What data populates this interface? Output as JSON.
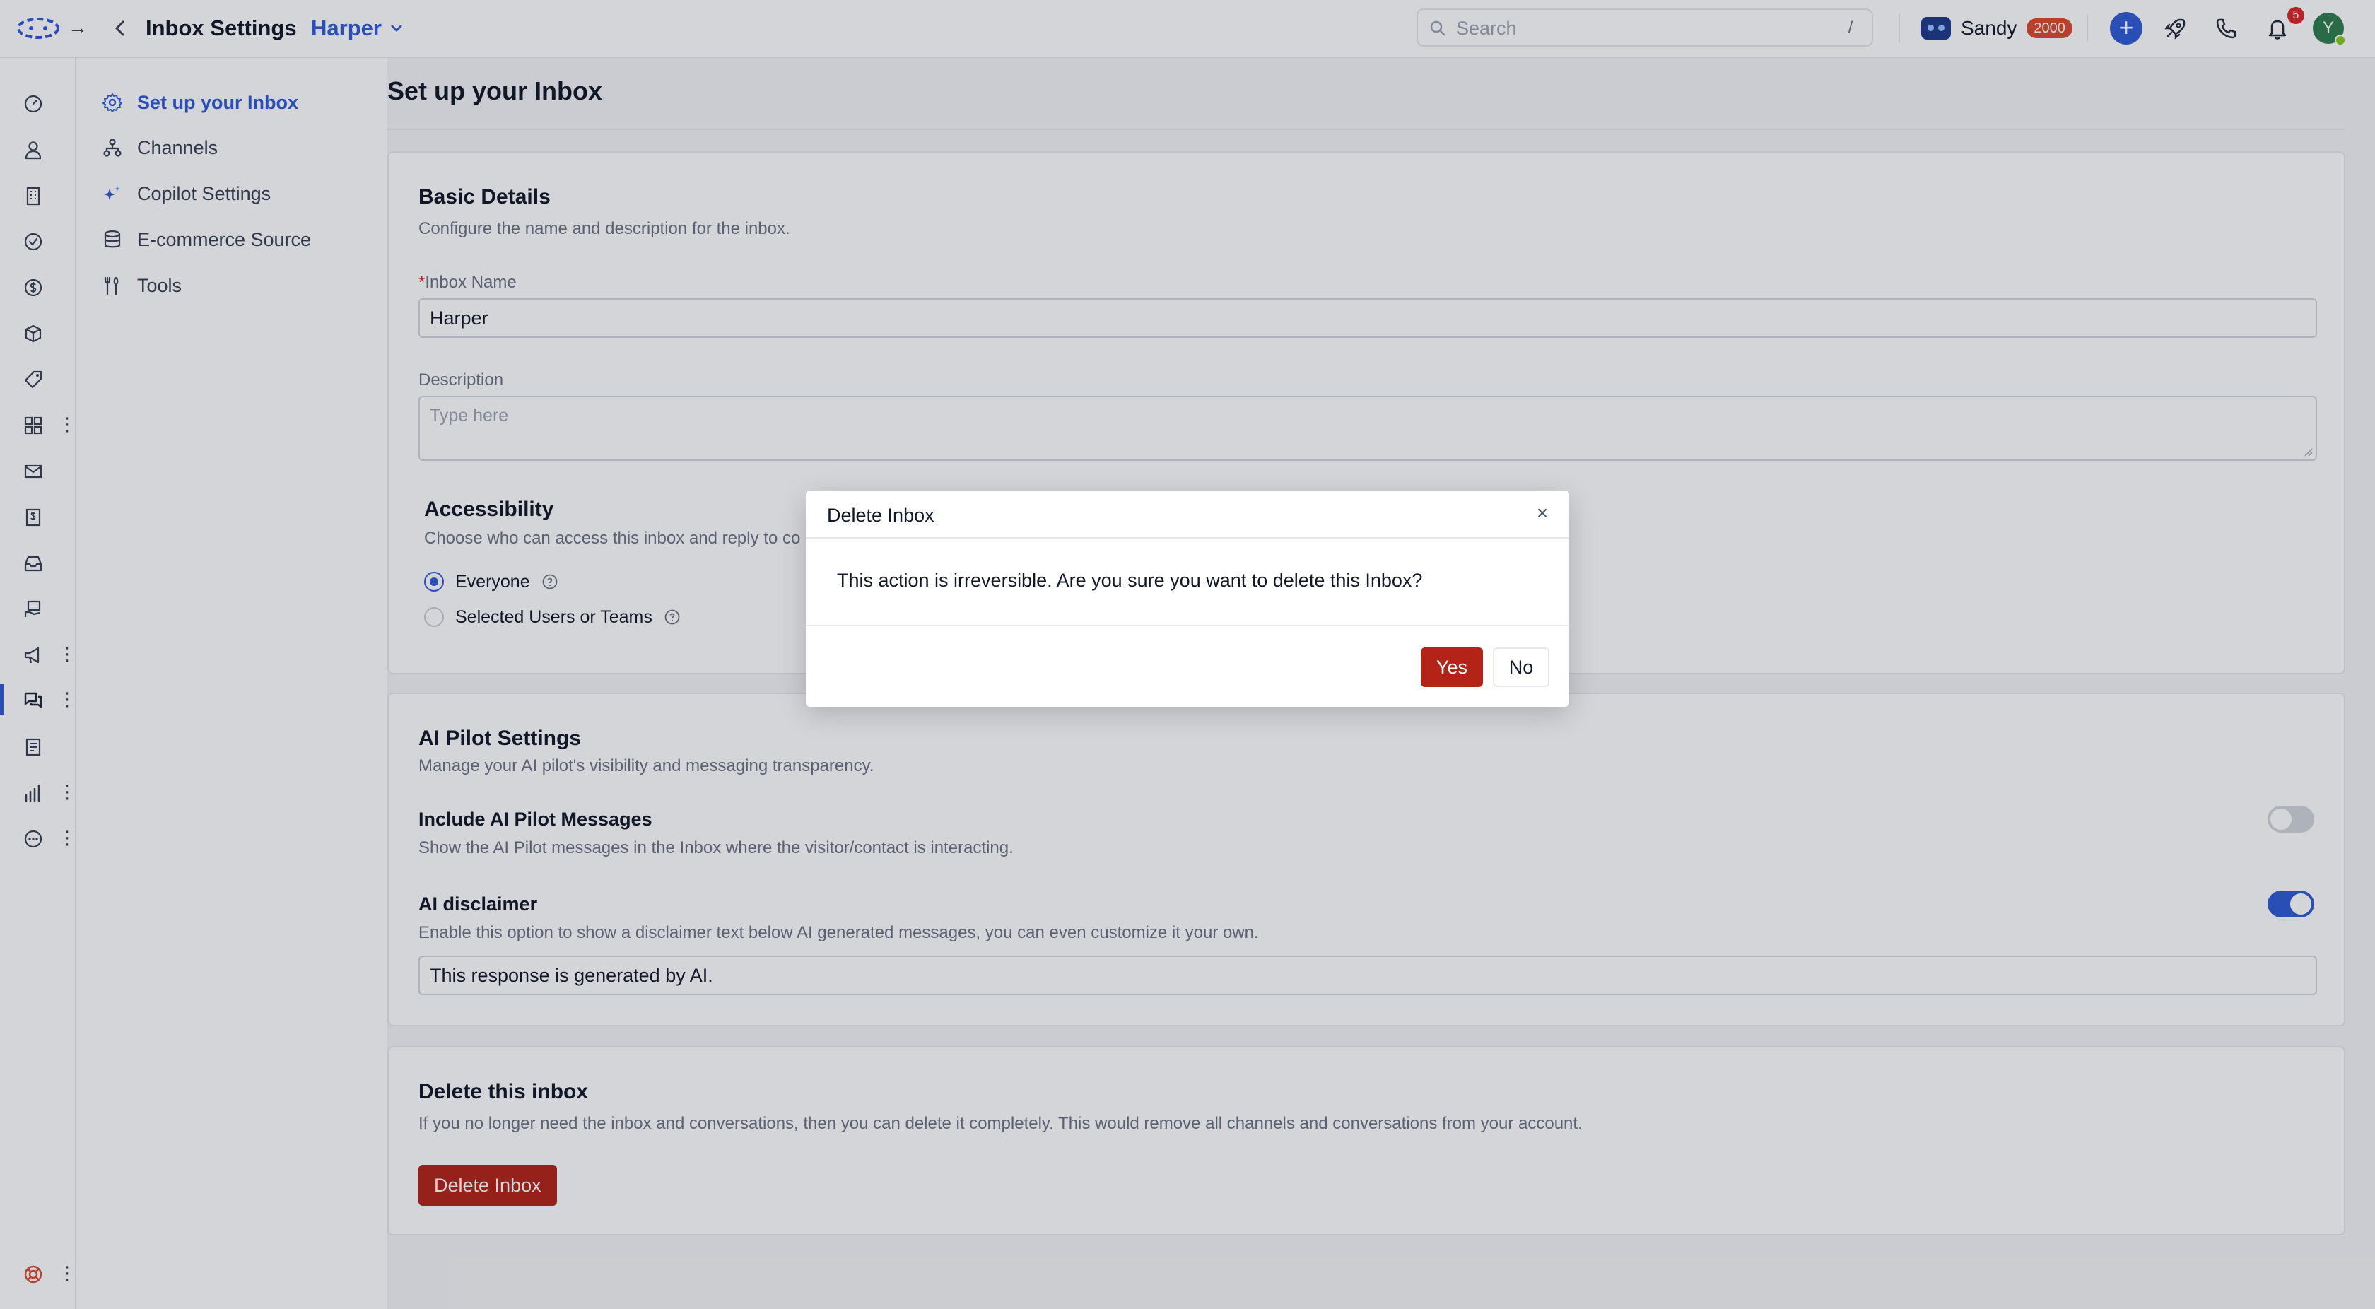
{
  "topbar": {
    "title": "Inbox Settings",
    "inbox_name": "Harper",
    "search_placeholder": "Search",
    "search_shortcut": "/",
    "agent_name": "Sandy",
    "agent_credits": "2000",
    "notification_count": "5",
    "avatar_initial": "Y"
  },
  "subnav": {
    "items": [
      {
        "label": "Set up your Inbox",
        "icon": "gear-icon",
        "active": true
      },
      {
        "label": "Channels",
        "icon": "channels-icon"
      },
      {
        "label": "Copilot Settings",
        "icon": "sparkle-icon"
      },
      {
        "label": "E-commerce Source",
        "icon": "database-icon"
      },
      {
        "label": "Tools",
        "icon": "tools-icon"
      }
    ]
  },
  "main": {
    "title": "Set up your Inbox",
    "basic": {
      "title": "Basic Details",
      "subtitle": "Configure the name and description for the inbox.",
      "name_required_mark": "*",
      "name_label": "Inbox Name",
      "name_value": "Harper",
      "description_label": "Description",
      "description_placeholder": "Type here",
      "accessibility_title": "Accessibility",
      "accessibility_subtitle": "Choose who can access this inbox and reply to co",
      "option_everyone": "Everyone",
      "option_selected": "Selected Users or Teams"
    },
    "ai": {
      "title": "AI Pilot Settings",
      "subtitle": "Manage your AI pilot's visibility and messaging transparency.",
      "include_title": "Include AI Pilot Messages",
      "include_desc": "Show the AI Pilot messages in the Inbox where the visitor/contact is interacting.",
      "include_on": false,
      "disclaimer_title": "AI disclaimer",
      "disclaimer_desc": "Enable this option to show a disclaimer text below AI generated messages, you can even customize it your own.",
      "disclaimer_on": true,
      "disclaimer_text": "This response is generated by AI."
    },
    "delete": {
      "title": "Delete this inbox",
      "desc": "If you no longer need the inbox and conversations, then you can delete it completely. This would remove all channels and conversations from your account.",
      "button": "Delete Inbox"
    }
  },
  "modal": {
    "title": "Delete Inbox",
    "close": "×",
    "message": "This action is irreversible. Are you sure you want to delete this Inbox?",
    "yes": "Yes",
    "no": "No"
  },
  "colors": {
    "accent": "#2f5bd6",
    "danger": "#b42318",
    "badge": "#dc4b2e"
  }
}
